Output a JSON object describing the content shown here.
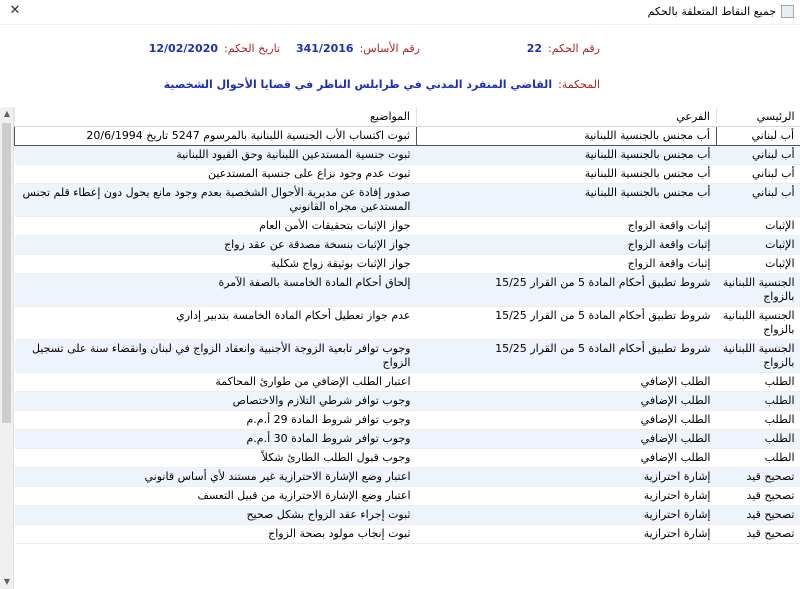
{
  "window": {
    "title": "جميع النقاط المتعلقة بالحكم",
    "close_glyph": "✕"
  },
  "info": {
    "ruling_number_label": "رقم الحكم:",
    "ruling_number": "22",
    "base_number_label": "رقم الأساس:",
    "base_number": "341/2016",
    "ruling_date_label": "تاريخ الحكم:",
    "ruling_date": "12/02/2020",
    "court_label": "المحكمة:",
    "court": "القاضي المنفرد المدني في طرابلس الناظر في قضايا الأحوال الشخصية"
  },
  "grid": {
    "headers": [
      "الرئيسي",
      "الفرعي",
      "المواضيع"
    ],
    "rows": [
      [
        "أب لبناني",
        "أب مجنس بالجنسية اللبنانية",
        "ثبوت اكتساب الأب الجنسية اللبنانية بالمرسوم 5247 تاريخ 20/6/1994"
      ],
      [
        "أب لبناني",
        "أب مجنس بالجنسية اللبنانية",
        "ثبوت جنسية المستدعين اللبنانية وحق القيود اللبنانية"
      ],
      [
        "أب لبناني",
        "أب مجنس بالجنسية اللبنانية",
        "ثبوت عدم وجود نزاع على جنسية المستدعين"
      ],
      [
        "أب لبناني",
        "أب مجنس بالجنسية اللبنانية",
        "صدور إفادة عن مديرية الأحوال الشخصية بعدم وجود مانع يحول دون إعطاء قلم تجنس المستدعين مجراه القانوني"
      ],
      [
        "الإثبات",
        "إثبات واقعة الزواج",
        "جواز الإثبات بتحقيقات الأمن العام"
      ],
      [
        "الإثبات",
        "إثبات واقعة الزواج",
        "جواز الإثبات بنسخة مصدقة عن عقد زواج"
      ],
      [
        "الإثبات",
        "إثبات واقعة الزواج",
        "جواز الإثبات بوثيقة زواج شكلية"
      ],
      [
        "الجنسية اللبنانية بالزواج",
        "شروط تطبيق أحكام المادة 5 من القرار 15/25",
        "إلحاق أحكام المادة الخامسة بالصفة الآمرة"
      ],
      [
        "الجنسية اللبنانية بالزواج",
        "شروط تطبيق أحكام المادة 5 من القرار 15/25",
        "عدم جواز تعطيل أحكام المادة الخامسة بتدبير إداري"
      ],
      [
        "الجنسية اللبنانية بالزواج",
        "شروط تطبيق أحكام المادة 5 من القرار 15/25",
        "وجوب توافر تابعية الزوجة الأجنبية وانعقاد الزواج في لبنان وانقضاء سنة على تسجيل الزواج"
      ],
      [
        "الطلب",
        "الطلب الإضافي",
        "اعتبار الطلب الإضافي من طوارئ المحاكمة"
      ],
      [
        "الطلب",
        "الطلب الإضافي",
        "وجوب توافر شرطي التلازم والاختصاص"
      ],
      [
        "الطلب",
        "الطلب الإضافي",
        "وجوب توافر شروط المادة 29 أ.م.م"
      ],
      [
        "الطلب",
        "الطلب الإضافي",
        "وجوب توافر شروط المادة 30 أ.م.م"
      ],
      [
        "الطلب",
        "الطلب الإضافي",
        "وجوب قبول الطلب الطارئ شكلاً"
      ],
      [
        "تصحيح قيد",
        "إشارة احترازية",
        "اعتبار وضع الإشارة الاحترازية غير مستند لأي أساس قانوني"
      ],
      [
        "تصحيح قيد",
        "إشارة احترازية",
        "اعتبار وضع الإشارة الاحترازية من قبيل التعسف"
      ],
      [
        "تصحيح قيد",
        "إشارة احترازية",
        "ثبوت إجراء عقد الزواج بشكل صحيح"
      ],
      [
        "تصحيح قيد",
        "إشارة احترازية",
        "ثبوت إنجاب مولود بصحة الزواج"
      ]
    ]
  }
}
